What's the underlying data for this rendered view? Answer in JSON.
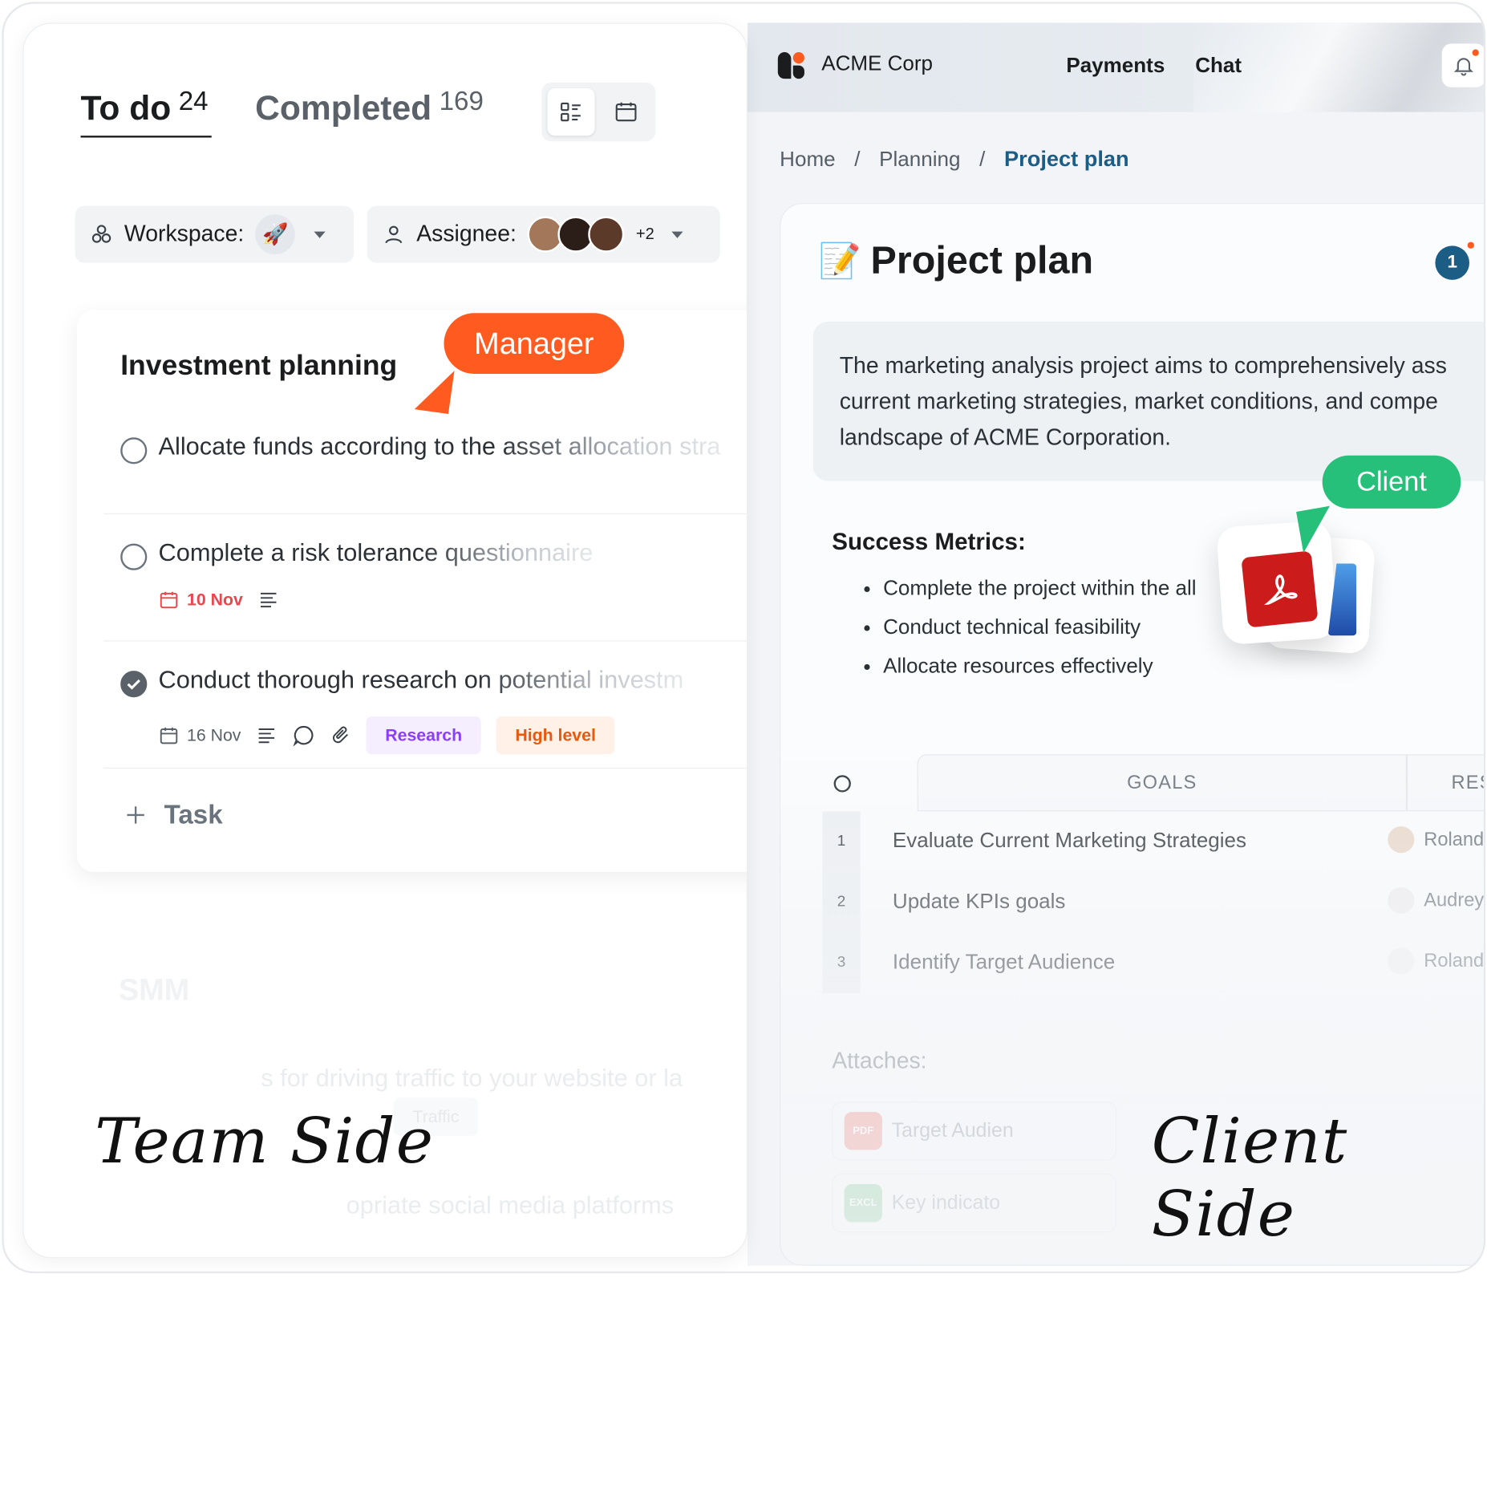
{
  "team": {
    "tabs": [
      {
        "label": "To do",
        "count": "24"
      },
      {
        "label": "Completed",
        "count": "169"
      }
    ],
    "filters": {
      "workspace_label": "Workspace:",
      "workspace_emoji": "🚀",
      "assignee_label": "Assignee:",
      "assignee_more": "+2"
    },
    "card": {
      "title": "Investment planning",
      "tasks": [
        {
          "text": "Allocate funds according to the asset allocation stra",
          "done": false
        },
        {
          "text": "Complete a risk tolerance questionnaire",
          "done": false,
          "date": "10 Nov",
          "date_color": "#e5484d"
        },
        {
          "text": "Conduct thorough research on potential investm",
          "done": true,
          "date": "16 Nov",
          "tags": [
            "Research",
            "High level"
          ]
        }
      ],
      "add_label": "Task"
    },
    "ghost": {
      "smm_title": "SMM",
      "line1": "s for driving traffic to your website or la",
      "tag": "Traffic",
      "line2": "opriate social media platforms"
    },
    "manager_bubble": "Manager",
    "caption": "Team Side"
  },
  "client": {
    "company": "ACME Corp",
    "nav": [
      "Payments",
      "Chat"
    ],
    "breadcrumb": [
      "Home",
      "Planning",
      "Project plan"
    ],
    "doc": {
      "emoji": "📝",
      "title": "Project plan",
      "notification_count": "1",
      "description": [
        "The marketing analysis project aims to comprehensively ass",
        "current marketing strategies, market conditions, and compe",
        "landscape of ACME Corporation."
      ],
      "success_title": "Success Metrics:",
      "success_items": [
        "Complete the project within the all",
        "Conduct technical feasibility",
        "Allocate resources effectively"
      ],
      "table": {
        "headers": [
          "GOALS",
          "RESPON"
        ],
        "rows": [
          {
            "num": "1",
            "goal": "Evaluate Current Marketing Strategies",
            "resp": "Roland"
          },
          {
            "num": "2",
            "goal": "Update KPIs goals",
            "resp": "Audrey"
          },
          {
            "num": "3",
            "goal": "Identify Target Audience",
            "resp": "Roland"
          }
        ]
      },
      "attaches_label": "Attaches:",
      "attachments": [
        {
          "type": "PDF",
          "name": "Target Audien",
          "color": "#f28b82"
        },
        {
          "type": "EXCL",
          "name": "Key indicato",
          "color": "#81c995"
        }
      ]
    },
    "client_bubble": "Client",
    "caption": "Client Side"
  },
  "colors": {
    "manager": "#ff5a1f",
    "client": "#27c07a",
    "accent": "#1c5d86",
    "research_tag": "#8a3ffc",
    "high_level_tag": "#e8590c"
  },
  "icons": [
    "list-view-icon",
    "calendar-view-icon",
    "workspace-icon",
    "user-icon",
    "bell-icon",
    "calendar-icon",
    "description-icon",
    "comment-icon",
    "attachment-icon",
    "plus-icon",
    "pdf-icon"
  ]
}
